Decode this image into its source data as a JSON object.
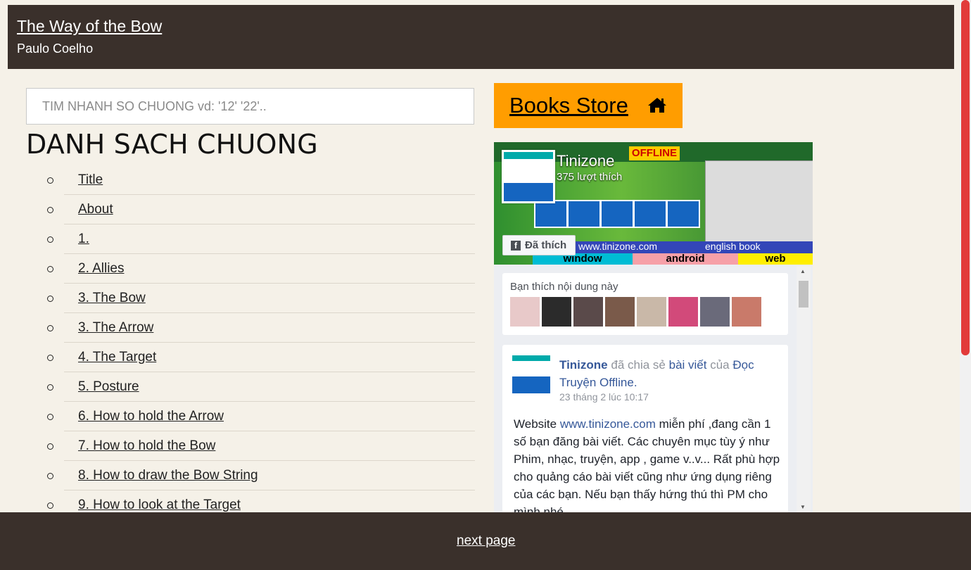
{
  "header": {
    "title": "The Way of the Bow",
    "author": "Paulo Coelho"
  },
  "search": {
    "placeholder": "TIM NHANH SO CHUONG vd: '12' '22'.."
  },
  "toc": {
    "heading": "DANH SACH CHUONG",
    "chapters": [
      "Title",
      "About",
      "1.",
      "2. Allies",
      "3. The Bow",
      "3. The Arrow",
      "4. The Target",
      "5. Posture",
      "6. How to hold the Arrow",
      "7. How to hold the Bow",
      "8. How to draw the Bow String",
      "9. How to look at the Target"
    ]
  },
  "books_store": {
    "label": "Books Store",
    "icon": "home-icon"
  },
  "fb_widget": {
    "cover_texts": {
      "banner_site": "tinizone.com",
      "offline": "OFFLINE",
      "site_url": "www.tinizone.com",
      "english_book": "english book",
      "strips": [
        "window",
        "android",
        "web"
      ]
    },
    "page_name": "Tinizone",
    "likes": "375 lượt thích",
    "liked_button": "Đã thích",
    "friends_label": "Bạn thích nội dung này",
    "post": {
      "author": "Tinizone",
      "shared": "đã chia sẻ",
      "post_link": "bài viết",
      "of": "của",
      "page_link": "Đọc Truyện Offline.",
      "time": "23 tháng 2 lúc 10:17",
      "text_prefix": "Website",
      "text_link": "www.tinizone.com",
      "text_rest": "miễn phí ,đang cần 1 số bạn đăng bài viết. Các chuyên mục tùy ý như Phim, nhạc, truyện, app , game v..v... Rất phù hợp cho quảng cáo bài viết cũng như ứng dụng riêng của các bạn. Nếu bạn thấy hứng thú thì PM cho mình nhé"
    },
    "avatar_colors": [
      "#e8c9c9",
      "#2b2b2b",
      "#5a4a4a",
      "#7a5a4a",
      "#c9b8a8",
      "#d24a7a",
      "#6a6a7a",
      "#c97a6a"
    ]
  },
  "footer": {
    "next_label": "next page"
  }
}
